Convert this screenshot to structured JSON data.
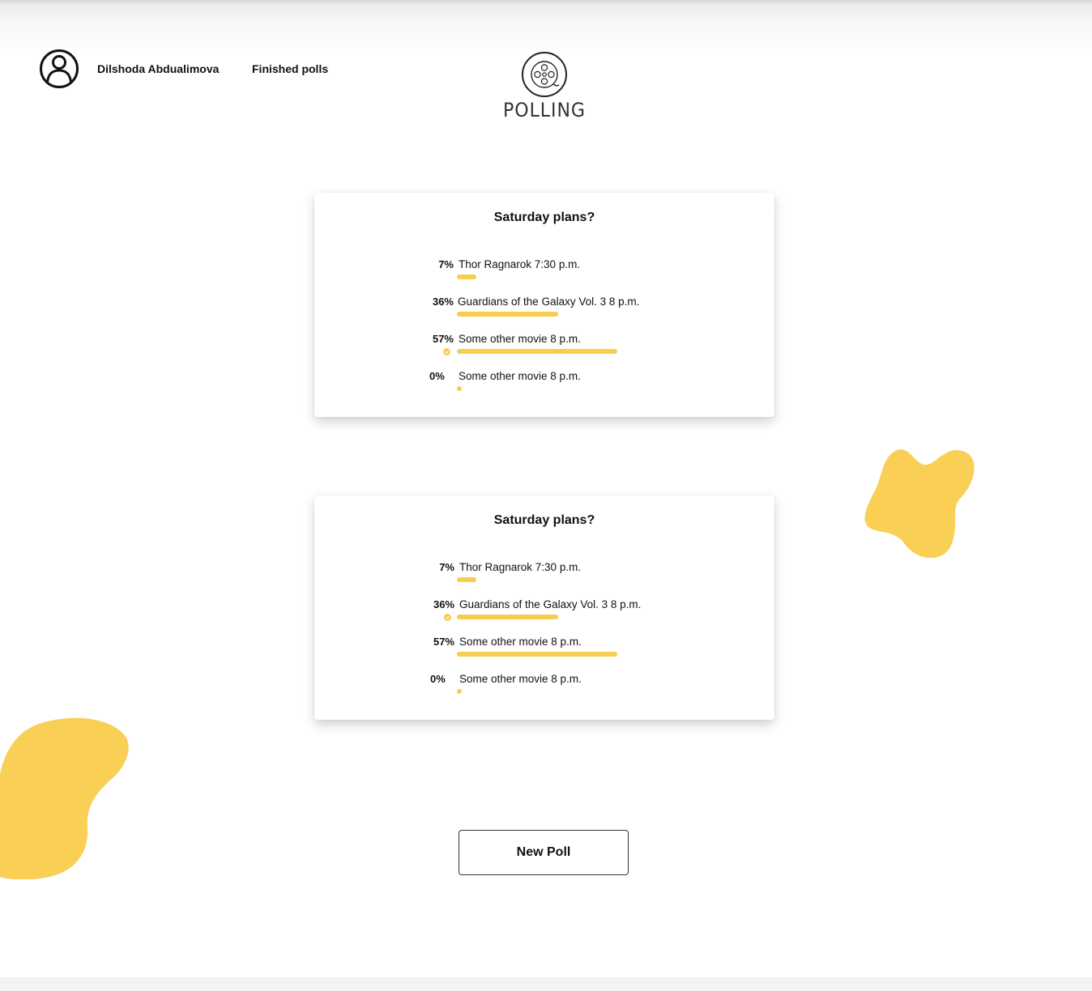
{
  "header": {
    "user_name": "Dilshoda Abdualimova",
    "finished_polls": "Finished polls",
    "logo_text": "POLLING"
  },
  "colors": {
    "accent": "#f7cd4f",
    "text": "#111111"
  },
  "polls": [
    {
      "question": "Saturday plans?",
      "options": [
        {
          "percent": "7%",
          "label": "Thor Ragnarok 7:30 p.m.",
          "share": 0.07,
          "selected": false
        },
        {
          "percent": "36%",
          "label": "Guardians of the Galaxy Vol. 3 8 p.m.",
          "share": 0.36,
          "selected": false
        },
        {
          "percent": "57%",
          "label": "Some other movie 8 p.m.",
          "share": 0.57,
          "selected": true
        },
        {
          "percent": "0%",
          "label": "Some other movie 8 p.m.",
          "share": 0,
          "selected": false
        }
      ]
    },
    {
      "question": "Saturday plans?",
      "options": [
        {
          "percent": "7%",
          "label": "Thor Ragnarok 7:30 p.m.",
          "share": 0.07,
          "selected": false
        },
        {
          "percent": "36%",
          "label": "Guardians of the Galaxy Vol. 3 8 p.m.",
          "share": 0.36,
          "selected": true
        },
        {
          "percent": "57%",
          "label": "Some other movie 8 p.m.",
          "share": 0.57,
          "selected": false
        },
        {
          "percent": "0%",
          "label": "Some other movie 8 p.m.",
          "share": 0,
          "selected": false
        }
      ]
    }
  ],
  "new_poll_button": "New Poll",
  "icons": {
    "avatar": "user-circle-icon",
    "logo": "film-reel-icon",
    "selected": "check-circle-icon"
  }
}
